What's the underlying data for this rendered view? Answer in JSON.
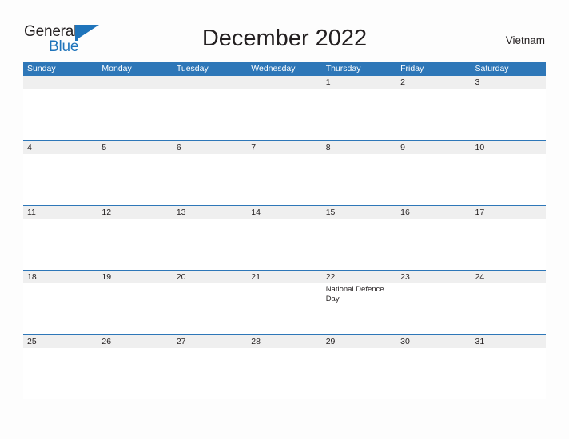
{
  "brand": {
    "name_part1": "General",
    "name_part2": "Blue",
    "flag_icon": "blue-triangle-flag-icon",
    "accent_color": "#1f74bb"
  },
  "header": {
    "title": "December 2022",
    "locale": "Vietnam"
  },
  "theme": {
    "header_blue": "#2e77b8",
    "band_gray": "#efefef",
    "text_dark": "#231f20",
    "page_background": "#fdfdfd"
  },
  "calendar": {
    "month": "December",
    "year": "2022",
    "weekday_headers": [
      "Sunday",
      "Monday",
      "Tuesday",
      "Wednesday",
      "Thursday",
      "Friday",
      "Saturday"
    ],
    "weeks": [
      {
        "days": [
          {
            "num": "",
            "event": ""
          },
          {
            "num": "",
            "event": ""
          },
          {
            "num": "",
            "event": ""
          },
          {
            "num": "",
            "event": ""
          },
          {
            "num": "1",
            "event": ""
          },
          {
            "num": "2",
            "event": ""
          },
          {
            "num": "3",
            "event": ""
          }
        ]
      },
      {
        "days": [
          {
            "num": "4",
            "event": ""
          },
          {
            "num": "5",
            "event": ""
          },
          {
            "num": "6",
            "event": ""
          },
          {
            "num": "7",
            "event": ""
          },
          {
            "num": "8",
            "event": ""
          },
          {
            "num": "9",
            "event": ""
          },
          {
            "num": "10",
            "event": ""
          }
        ]
      },
      {
        "days": [
          {
            "num": "11",
            "event": ""
          },
          {
            "num": "12",
            "event": ""
          },
          {
            "num": "13",
            "event": ""
          },
          {
            "num": "14",
            "event": ""
          },
          {
            "num": "15",
            "event": ""
          },
          {
            "num": "16",
            "event": ""
          },
          {
            "num": "17",
            "event": ""
          }
        ]
      },
      {
        "days": [
          {
            "num": "18",
            "event": ""
          },
          {
            "num": "19",
            "event": ""
          },
          {
            "num": "20",
            "event": ""
          },
          {
            "num": "21",
            "event": ""
          },
          {
            "num": "22",
            "event": "National Defence Day"
          },
          {
            "num": "23",
            "event": ""
          },
          {
            "num": "24",
            "event": ""
          }
        ]
      },
      {
        "days": [
          {
            "num": "25",
            "event": ""
          },
          {
            "num": "26",
            "event": ""
          },
          {
            "num": "27",
            "event": ""
          },
          {
            "num": "28",
            "event": ""
          },
          {
            "num": "29",
            "event": ""
          },
          {
            "num": "30",
            "event": ""
          },
          {
            "num": "31",
            "event": ""
          }
        ]
      }
    ]
  }
}
